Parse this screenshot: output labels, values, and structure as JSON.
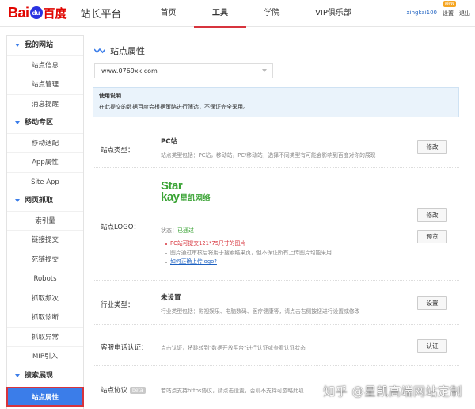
{
  "header": {
    "logo_bai": "Bai",
    "logo_du": "du",
    "logo_baidu": "百度",
    "platform": "站长平台",
    "nav": [
      {
        "label": "首页",
        "active": false
      },
      {
        "label": "工具",
        "active": true
      },
      {
        "label": "学院",
        "active": false
      },
      {
        "label": "VIP俱乐部",
        "active": false
      }
    ],
    "user": {
      "username": "xingkai100",
      "settings": "设置",
      "new_badge": "New",
      "logout": "退出"
    }
  },
  "sidebar": {
    "sections": [
      {
        "title": "我的网站",
        "items": [
          "站点信息",
          "站点管理",
          "消息提醒"
        ]
      },
      {
        "title": "移动专区",
        "items": [
          "移动适配",
          "App属性",
          "Site App"
        ]
      },
      {
        "title": "网页抓取",
        "items": [
          "索引量",
          "链接提交",
          "死链提交",
          "Robots",
          "抓取频次",
          "抓取诊断",
          "抓取异常",
          "MIP引入"
        ]
      },
      {
        "title": "搜索展现",
        "items": [
          "站点属性"
        ]
      }
    ],
    "active_item": "站点属性"
  },
  "main": {
    "title": "站点属性",
    "site_select": "www.0769xk.com",
    "notice": {
      "title": "使用说明",
      "text": "在此提交的数据百度会根据策略进行筛选，不保证完全采用。"
    },
    "site_type": {
      "label": "站点类型：",
      "value": "PC站",
      "desc": "站点类型包括：PC站，移动站，PC/移动站，选择不同类型有可能会影响到百度对你的展现",
      "button": "修改"
    },
    "site_logo": {
      "label": "站点LOGO：",
      "logo_line1": "Star",
      "logo_line2": "kay",
      "logo_cn": "星凯网络",
      "status_label": "状态：",
      "status_value": "已通过",
      "bullet1": "PC站可提交121*75尺寸的图片",
      "bullet2": "图片通过审核后将用于搜索结果页，但不保证所有上传图片均能采用",
      "bullet3": "如何正确上传logo?",
      "button_edit": "修改",
      "button_preview": "预览"
    },
    "industry": {
      "label": "行业类型：",
      "value": "未设置",
      "desc": "行业类型包括：影视娱乐、电脑数码、医疗健康等，请点击右侧按钮进行设置或修改",
      "button": "设置"
    },
    "phone": {
      "label": "客服电话认证：",
      "desc": "点击认证，将跳转到\"数据开放平台\"进行认证或查看认证状态",
      "button": "认证"
    },
    "https": {
      "label": "站点协议",
      "badge": "beta",
      "desc": "若站点支持https协议，请点击设置，否则不支持可忽略此项"
    },
    "watermark": "知乎 @星凯高端网站定制"
  }
}
